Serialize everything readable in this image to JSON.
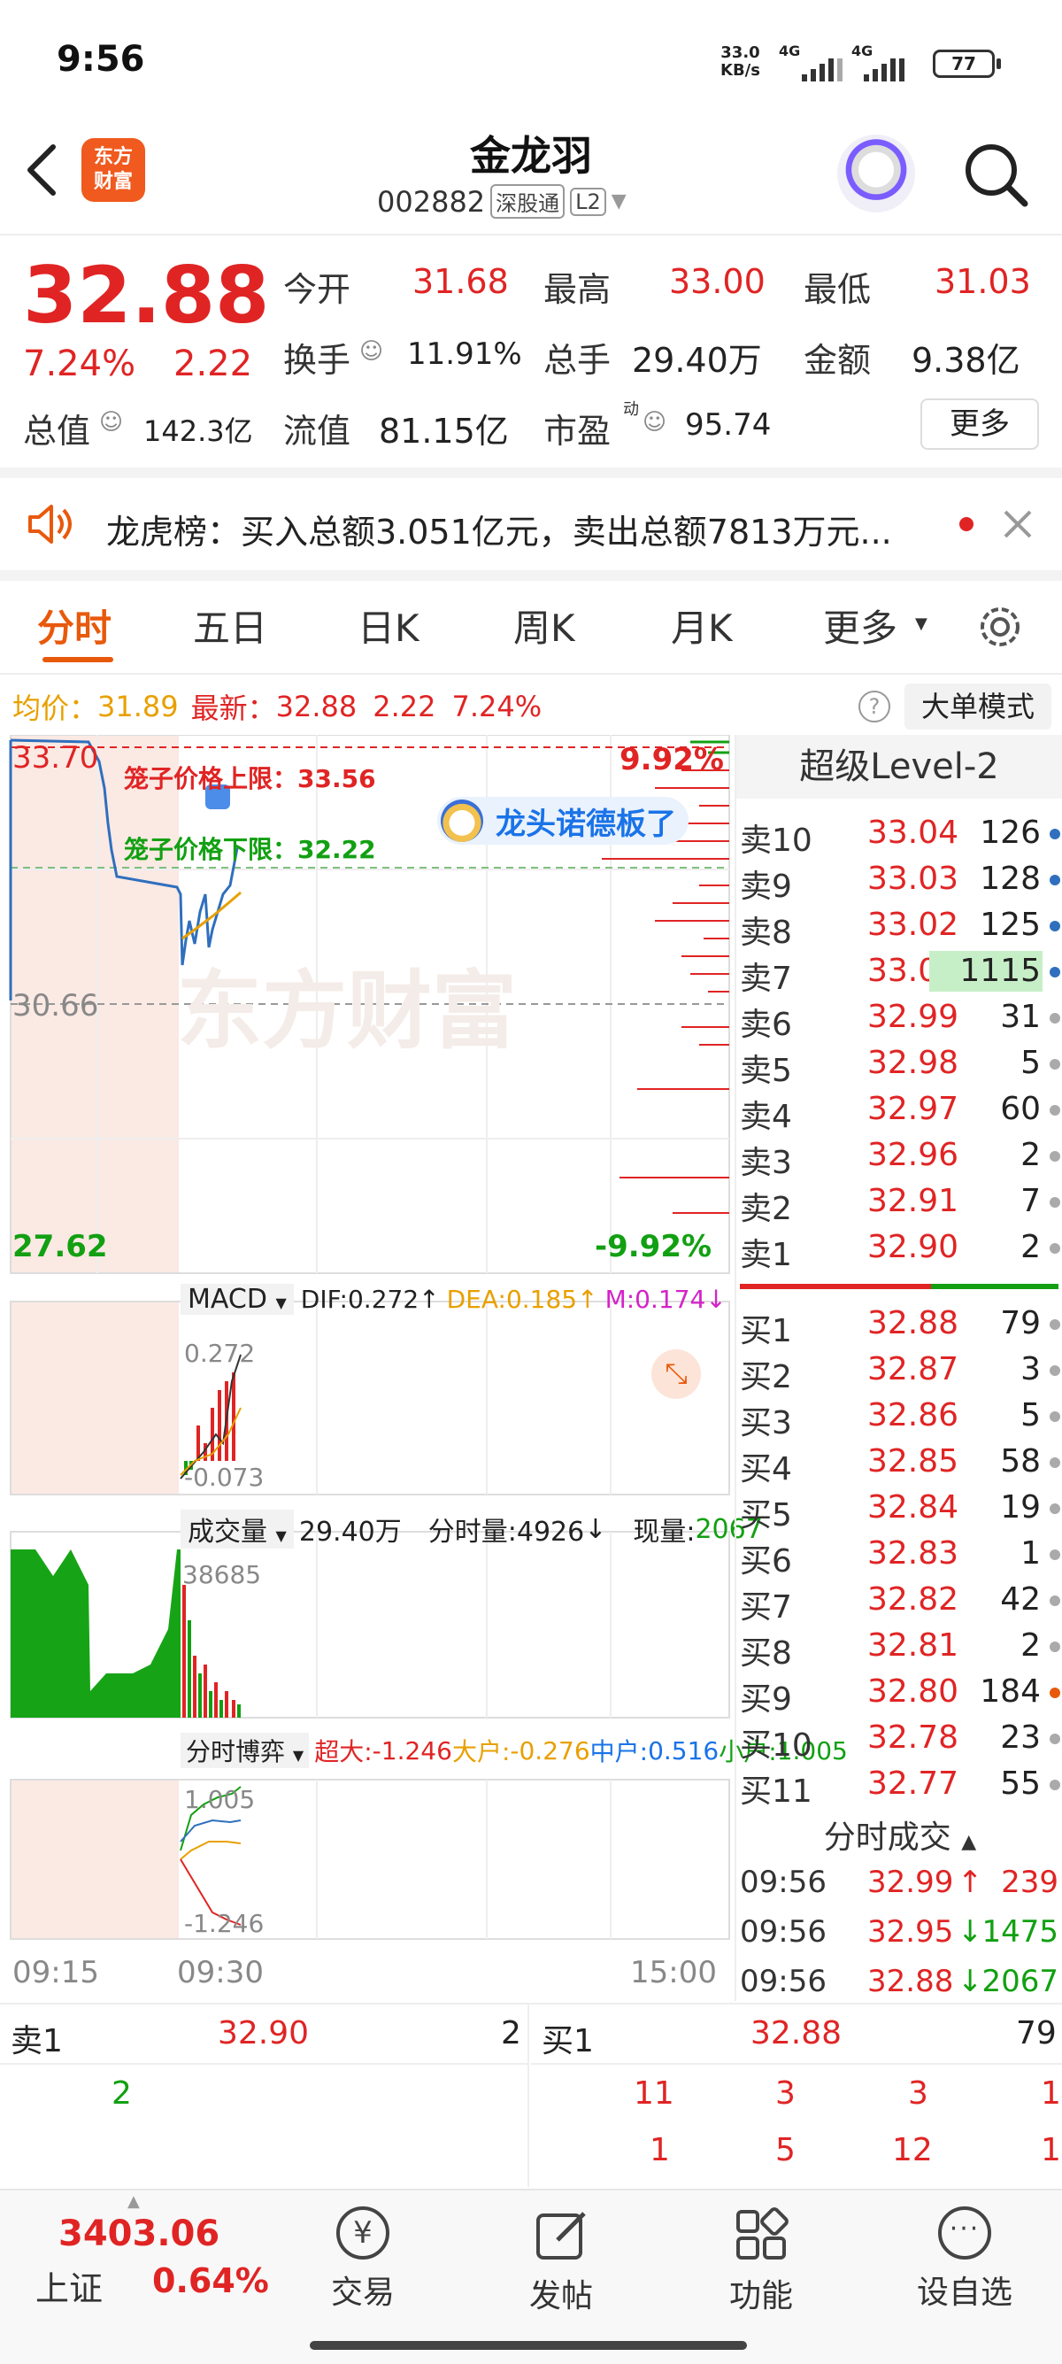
{
  "status": {
    "time": "9:56",
    "speed_val": "33.0",
    "speed_unit": "KB/s",
    "sig1": "4G",
    "sig2": "4G",
    "battery": "77"
  },
  "header": {
    "logo_line1": "东方",
    "logo_line2": "财富",
    "name": "金龙羽",
    "code": "002882",
    "tag1": "深股通",
    "tag2": "L2"
  },
  "quote": {
    "price": "32.88",
    "pct": "7.24%",
    "chg": "2.22",
    "open_l": "今开",
    "open_v": "31.68",
    "high_l": "最高",
    "high_v": "33.00",
    "low_l": "最低",
    "low_v": "31.03",
    "turn_l": "换手",
    "turn_v": "11.91%",
    "vol_l": "总手",
    "vol_v": "29.40万",
    "amt_l": "金额",
    "amt_v": "9.38亿",
    "mcap_l": "总值",
    "mcap_v": "142.3亿",
    "flt_l": "流值",
    "flt_v": "81.15亿",
    "pe_l": "市盈",
    "pe_sup": "动",
    "pe_v": "95.74",
    "more": "更多"
  },
  "notice": {
    "text": "龙虎榜：买入总额3.051亿元，卖出总额7813万元..."
  },
  "tabs": [
    "分时",
    "五日",
    "日K",
    "周K",
    "月K",
    "更多"
  ],
  "avgbar": {
    "avg_l": "均价：",
    "avg_v": "31.89",
    "new_l": "最新：",
    "new_v": "32.88",
    "chg": "2.22",
    "pct": "7.24%",
    "big": "大单模式"
  },
  "chart": {
    "ymax": "33.70",
    "ymid": "30.66",
    "ymin": "27.62",
    "pmax": "9.92%",
    "pmin": "-9.92%",
    "cap_up": "笼子价格上限：33.56",
    "cap_dn": "笼子价格下限：32.22",
    "badge": "龙头诺德板了",
    "watermark": "东方财富",
    "macd_l": "MACD",
    "dif": "DIF:0.272",
    "dea": "DEA:0.185",
    "m": "M:0.174",
    "macd_top": "0.272",
    "macd_bot": "-0.073",
    "vol_l": "成交量",
    "vol_total": "29.40万",
    "vol_tick": "分时量:4926",
    "vol_now_l": "现量:",
    "vol_now": "2067",
    "vol_max": "38685",
    "bo_l": "分时博弈",
    "bo_big_l": "超大:",
    "bo_big": "-1.246",
    "bo_lg_l": "大户:",
    "bo_lg": "-0.276",
    "bo_md_l": "中户:",
    "bo_md": "0.516",
    "bo_sm_l": "小户:",
    "bo_sm": "1.005",
    "bo_top": "1.005",
    "bo_bot": "-1.246",
    "t0": "09:15",
    "t1": "09:30",
    "t2": "15:00"
  },
  "level2": {
    "title": "超级Level-2",
    "asks": [
      {
        "l": "卖10",
        "p": "33.04",
        "v": "126"
      },
      {
        "l": "卖9",
        "p": "33.03",
        "v": "128"
      },
      {
        "l": "卖8",
        "p": "33.02",
        "v": "125"
      },
      {
        "l": "卖7",
        "p": "33.00",
        "v": "1115"
      },
      {
        "l": "卖6",
        "p": "32.99",
        "v": "31"
      },
      {
        "l": "卖5",
        "p": "32.98",
        "v": "5"
      },
      {
        "l": "卖4",
        "p": "32.97",
        "v": "60"
      },
      {
        "l": "卖3",
        "p": "32.96",
        "v": "2"
      },
      {
        "l": "卖2",
        "p": "32.91",
        "v": "7"
      },
      {
        "l": "卖1",
        "p": "32.90",
        "v": "2"
      }
    ],
    "bids": [
      {
        "l": "买1",
        "p": "32.88",
        "v": "79"
      },
      {
        "l": "买2",
        "p": "32.87",
        "v": "3"
      },
      {
        "l": "买3",
        "p": "32.86",
        "v": "5"
      },
      {
        "l": "买4",
        "p": "32.85",
        "v": "58"
      },
      {
        "l": "买5",
        "p": "32.84",
        "v": "19"
      },
      {
        "l": "买6",
        "p": "32.83",
        "v": "1"
      },
      {
        "l": "买7",
        "p": "32.82",
        "v": "42"
      },
      {
        "l": "买8",
        "p": "32.81",
        "v": "2"
      },
      {
        "l": "买9",
        "p": "32.80",
        "v": "184"
      },
      {
        "l": "买10",
        "p": "32.78",
        "v": "23"
      },
      {
        "l": "买11",
        "p": "32.77",
        "v": "55"
      }
    ],
    "trades_title": "分时成交",
    "trades": [
      {
        "t": "09:56",
        "p": "32.99",
        "dir": "↑",
        "v": "239"
      },
      {
        "t": "09:56",
        "p": "32.95",
        "dir": "↓",
        "v": "1475"
      },
      {
        "t": "09:56",
        "p": "32.88",
        "dir": "↓",
        "v": "2067"
      }
    ]
  },
  "queue": {
    "ask_l": "卖1",
    "ask_p": "32.90",
    "ask_v": "2",
    "ask_q": [
      "2"
    ],
    "bid_l": "买1",
    "bid_p": "32.88",
    "bid_v": "79",
    "bid_q1": [
      "11",
      "3",
      "3",
      "1"
    ],
    "bid_q2": [
      "1",
      "5",
      "12",
      "1"
    ]
  },
  "bottom": {
    "idx_v": "3403.06",
    "idx_n": "上证",
    "idx_p": "0.64%",
    "trade": "交易",
    "post": "发帖",
    "func": "功能",
    "fav": "设自选"
  },
  "colors": {
    "up": "#e02424",
    "down": "#12a012",
    "accent": "#e8590c",
    "avg": "#e8a000",
    "price_line": "#2f6fbd"
  }
}
